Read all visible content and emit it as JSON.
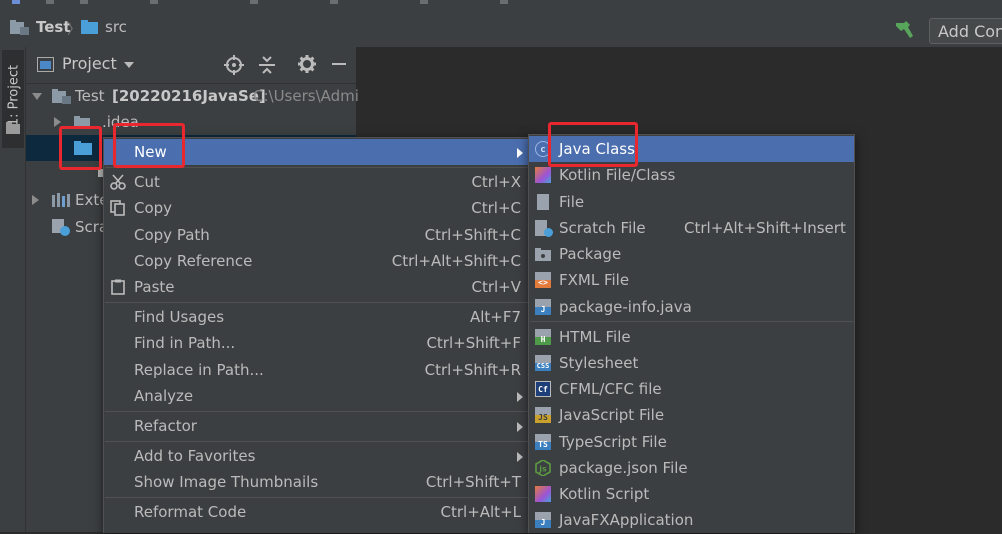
{
  "navbar": {
    "crumb_project": "Test",
    "crumb_src": "src",
    "add_config_label": "Add Con"
  },
  "tool_strip": {
    "project_label": "1: Project"
  },
  "project_panel": {
    "title": "Project",
    "root": {
      "name": "Test",
      "module": "[20220216JavaSe]",
      "path": "C:\\Users\\Admi"
    },
    "idea_label": ".idea",
    "external_label": "Exte",
    "scratches_label": "Scra"
  },
  "context_menu": {
    "new_label": "New",
    "cut_label": "Cut",
    "cut_shortcut": "Ctrl+X",
    "copy_label": "Copy",
    "copy_shortcut": "Ctrl+C",
    "copy_path_label": "Copy Path",
    "copy_path_shortcut": "Ctrl+Shift+C",
    "copy_reference_label": "Copy Reference",
    "copy_reference_shortcut": "Ctrl+Alt+Shift+C",
    "paste_label": "Paste",
    "paste_shortcut": "Ctrl+V",
    "find_usages_label": "Find Usages",
    "find_usages_shortcut": "Alt+F7",
    "find_in_path_label": "Find in Path...",
    "find_in_path_shortcut": "Ctrl+Shift+F",
    "replace_in_path_label": "Replace in Path...",
    "replace_in_path_shortcut": "Ctrl+Shift+R",
    "analyze_label": "Analyze",
    "refactor_label": "Refactor",
    "add_to_favorites_label": "Add to Favorites",
    "show_thumbnails_label": "Show Image Thumbnails",
    "show_thumbnails_shortcut": "Ctrl+Shift+T",
    "reformat_code_label": "Reformat Code",
    "reformat_code_shortcut": "Ctrl+Alt+L"
  },
  "new_submenu": {
    "items": [
      {
        "label": "Java Class",
        "icon": "java-class-icon"
      },
      {
        "label": "Kotlin File/Class",
        "icon": "kotlin-file-icon"
      },
      {
        "label": "File",
        "icon": "file-icon"
      },
      {
        "label": "Scratch File",
        "shortcut": "Ctrl+Alt+Shift+Insert",
        "icon": "scratch-file-icon"
      },
      {
        "label": "Package",
        "icon": "package-icon"
      },
      {
        "label": "FXML File",
        "icon": "fxml-file-icon"
      },
      {
        "label": "package-info.java",
        "icon": "java-file-icon"
      },
      {
        "label": "HTML File",
        "icon": "html-file-icon"
      },
      {
        "label": "Stylesheet",
        "icon": "css-file-icon"
      },
      {
        "label": "CFML/CFC file",
        "icon": "cfml-file-icon"
      },
      {
        "label": "JavaScript File",
        "icon": "js-file-icon"
      },
      {
        "label": "TypeScript File",
        "icon": "ts-file-icon"
      },
      {
        "label": "package.json File",
        "icon": "nodejs-icon"
      },
      {
        "label": "Kotlin Script",
        "icon": "kotlin-script-icon"
      },
      {
        "label": "JavaFXApplication",
        "icon": "javafx-icon"
      }
    ]
  },
  "colors": {
    "selection": "#4b6eaf",
    "highlight_box": "#e8272e",
    "panel_bg": "#3c3f41",
    "editor_bg": "#2b2b2b"
  }
}
